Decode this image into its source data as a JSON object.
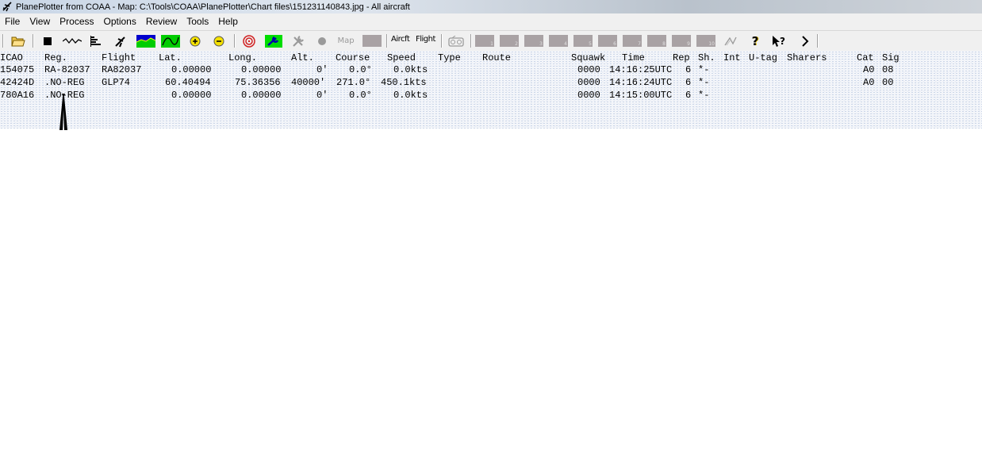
{
  "window": {
    "title": "PlanePlotter from COAA - Map: C:\\Tools\\COAA\\PlanePlotter\\Chart files\\151231140843.jpg - All aircraft"
  },
  "menu": [
    "File",
    "View",
    "Process",
    "Options",
    "Review",
    "Tools",
    "Help"
  ],
  "toolbar": {
    "aircraft_label": "Aircft",
    "flight_label": "Flight",
    "map_label": "Map",
    "gray_buttons": [
      "1",
      "2",
      "3",
      "4",
      "5",
      "6",
      "7",
      "8",
      "9",
      "10"
    ],
    "icons": [
      "open-folder-icon",
      "stop-icon",
      "waveform-icon",
      "bar-list-icon",
      "aircraft-icon",
      "map-chart-icon",
      "curve-chart-icon",
      "zoom-in-icon",
      "zoom-out-icon",
      "target-icon",
      "tools-green-icon",
      "wrench-disabled-icon",
      "record-icon",
      "map-disabled-icon",
      "gray-block-icon",
      "aircraft-text-icon",
      "flight-text-icon",
      "radio-icon",
      "pen-disabled-icon",
      "help-icon",
      "context-help-icon",
      "next-icon"
    ]
  },
  "table": {
    "columns": [
      {
        "key": "icao",
        "label": "ICAO"
      },
      {
        "key": "reg",
        "label": "Reg."
      },
      {
        "key": "flight",
        "label": "Flight"
      },
      {
        "key": "lat",
        "label": "Lat."
      },
      {
        "key": "long",
        "label": "Long."
      },
      {
        "key": "alt",
        "label": "Alt."
      },
      {
        "key": "course",
        "label": "Course"
      },
      {
        "key": "speed",
        "label": "Speed"
      },
      {
        "key": "type",
        "label": "Type"
      },
      {
        "key": "route",
        "label": "Route"
      },
      {
        "key": "squawk",
        "label": "Squawk"
      },
      {
        "key": "time",
        "label": "Time"
      },
      {
        "key": "rep",
        "label": "Rep"
      },
      {
        "key": "sh",
        "label": "Sh."
      },
      {
        "key": "int",
        "label": "Int"
      },
      {
        "key": "utag",
        "label": "U-tag"
      },
      {
        "key": "sharers",
        "label": "Sharers"
      },
      {
        "key": "cat",
        "label": "Cat"
      },
      {
        "key": "sig",
        "label": "Sig"
      }
    ],
    "rows": [
      {
        "icao": "154075",
        "reg": "RA-82037",
        "flight": "RA82037",
        "lat": "0.00000",
        "long": "0.00000",
        "alt": "0'",
        "course": "0.0°",
        "speed": "0.0kts",
        "type": "",
        "route": "",
        "squawk": "0000",
        "time": "14:16:25UTC",
        "rep": "6",
        "sh": "*-",
        "int": "",
        "utag": "",
        "sharers": "",
        "cat": "A0",
        "sig": "08"
      },
      {
        "icao": "42424D",
        "reg": ".NO-REG",
        "flight": "GLP74",
        "lat": "60.40494",
        "long": "75.36356",
        "alt": "40000'",
        "course": "271.0°",
        "speed": "450.1kts",
        "type": "",
        "route": "",
        "squawk": "0000",
        "time": "14:16:24UTC",
        "rep": "6",
        "sh": "*-",
        "int": "",
        "utag": "",
        "sharers": "",
        "cat": "A0",
        "sig": "00"
      },
      {
        "icao": "780A16",
        "reg": ".NO-REG",
        "flight": "",
        "lat": "0.00000",
        "long": "0.00000",
        "alt": "0'",
        "course": "0.0°",
        "speed": "0.0kts",
        "type": "",
        "route": "",
        "squawk": "0000",
        "time": "14:15:00UTC",
        "rep": "6",
        "sh": "*-",
        "int": "",
        "utag": "",
        "sharers": "",
        "cat": "",
        "sig": ""
      }
    ]
  }
}
